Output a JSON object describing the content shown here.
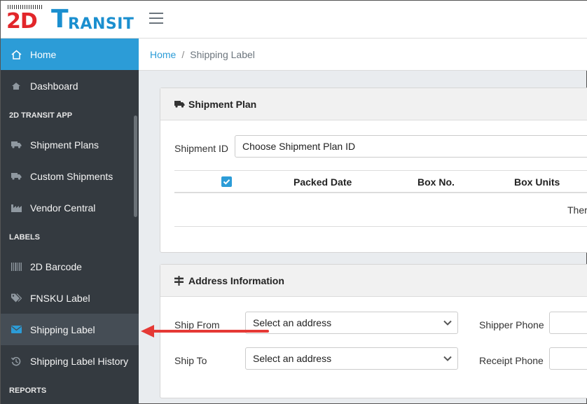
{
  "brand": {
    "logo_2d": "2D",
    "logo_t": "T",
    "logo_rest": "RANSIT"
  },
  "sidebar": {
    "home": "Home",
    "dashboard": "Dashboard",
    "section_app": "2D TRANSIT APP",
    "shipment_plans": "Shipment Plans",
    "custom_shipments": "Custom Shipments",
    "vendor_central": "Vendor Central",
    "section_labels": "LABELS",
    "barcode_2d": "2D Barcode",
    "fnsku_label": "FNSKU Label",
    "shipping_label": "Shipping Label",
    "shipping_label_history": "Shipping Label History",
    "section_reports": "REPORTS"
  },
  "breadcrumb": {
    "home": "Home",
    "separator": "/",
    "current": "Shipping Label"
  },
  "shipment_plan": {
    "title": "Shipment Plan",
    "shipment_id_label": "Shipment ID",
    "shipment_id_value": "Choose Shipment Plan ID",
    "columns": {
      "packed_date": "Packed Date",
      "box_no": "Box No.",
      "box_units": "Box Units"
    },
    "empty_text": "Ther"
  },
  "address": {
    "title": "Address Information",
    "ship_from_label": "Ship From",
    "ship_from_value": "Select an address",
    "ship_to_label": "Ship To",
    "ship_to_value": "Select an address",
    "shipper_phone_label": "Shipper Phone",
    "receipt_phone_label": "Receipt Phone"
  },
  "colors": {
    "accent": "#2c9cd7",
    "sidebar_bg": "#343a40",
    "arrow": "#e53935",
    "logo_red": "#e2262a",
    "logo_blue": "#1b8fcf"
  },
  "icons": [
    "home-icon",
    "dashboard-icon",
    "truck-icon",
    "factory-icon",
    "barcode-icon",
    "tags-icon",
    "envelope-icon",
    "history-icon",
    "menu-icon",
    "chevron-down-icon",
    "sign-icon",
    "check-icon"
  ]
}
